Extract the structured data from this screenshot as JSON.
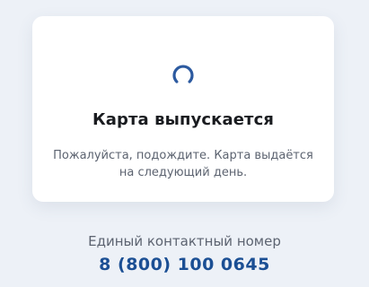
{
  "card": {
    "spinner_icon": "loading-spinner-icon",
    "spinner_color": "#2c5aa0",
    "title": "Карта выпускается",
    "message": "Пожалуйста, подождите. Карта выдаётся на следующий день."
  },
  "contact": {
    "label": "Единый контактный номер",
    "phone": "8 (800) 100 0645",
    "phone_color": "#1b4f94"
  }
}
